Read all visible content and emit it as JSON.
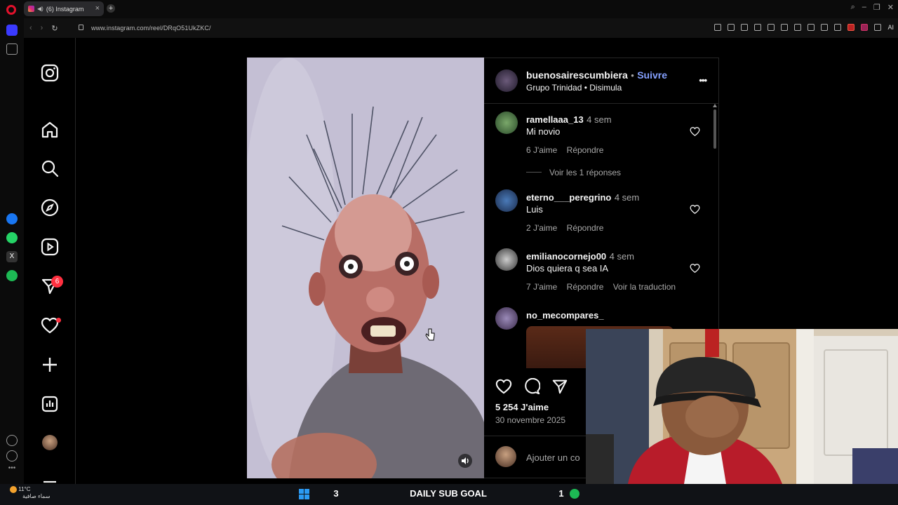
{
  "browser": {
    "tab_title": "(6) Instagram",
    "url": "www.instagram.com/reel/DRqO51UkZKC/",
    "ai_label": "AI"
  },
  "nav": {
    "notifications_count": "6",
    "icons": [
      "instagram-logo-icon",
      "home-icon",
      "search-icon",
      "explore-icon",
      "reels-icon",
      "messages-icon",
      "notifications-icon",
      "create-icon",
      "dashboard-icon",
      "profile-avatar",
      "more-icon"
    ]
  },
  "post": {
    "author": "buenosairescumbiera",
    "separator": "•",
    "follow_label": "Suivre",
    "audio": "Grupo Trinidad • Disimula",
    "more_label": "•••"
  },
  "comments": [
    {
      "user": "ramellaaa_13",
      "time": "4 sem",
      "text": "Mi novio",
      "likes": "6 J'aime",
      "reply": "Répondre",
      "view_replies": "Voir les 1 réponses"
    },
    {
      "user": "eterno___peregrino",
      "time": "4 sem",
      "text": "Luis",
      "likes": "2 J'aime",
      "reply": "Répondre"
    },
    {
      "user": "emilianocornejo00",
      "time": "4 sem",
      "text": "Dios quiera q sea IA",
      "likes": "7 J'aime",
      "reply": "Répondre",
      "translate": "Voir la traduction"
    },
    {
      "user": "no_mecompares_",
      "time": "",
      "text": ""
    }
  ],
  "actions": {
    "likes_count": "5 254 J'aime",
    "date": "30 novembre 2025",
    "add_comment_placeholder": "Ajouter un co"
  },
  "taskbar": {
    "temperature": "11°C",
    "weather_text": "سماء صافية",
    "sub_goal_left": "3",
    "sub_goal_label": "DAILY SUB GOAL",
    "sub_goal_right": "1"
  },
  "colors": {
    "follow_blue": "#85a1ff",
    "notif_red": "#ff3040",
    "opera_red": "#e3112c",
    "spotify_green": "#1db954"
  }
}
